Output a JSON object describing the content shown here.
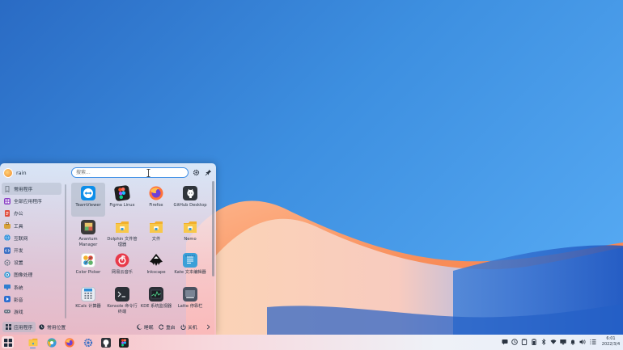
{
  "launcher": {
    "username": "rain",
    "search_placeholder": "搜索...",
    "sidebar": [
      {
        "label": "常用程序",
        "icon": "bookmark-icon",
        "color": "#6b7480"
      },
      {
        "label": "全部应用程序",
        "icon": "apps-grid-icon",
        "color": "#8a3fc4"
      },
      {
        "label": "办公",
        "icon": "office-icon",
        "color": "#e04a3a"
      },
      {
        "label": "工具",
        "icon": "tools-icon",
        "color": "#d8a23a"
      },
      {
        "label": "互联网",
        "icon": "globe-icon",
        "color": "#2e8fd8"
      },
      {
        "label": "开发",
        "icon": "code-icon",
        "color": "#3a6fc4"
      },
      {
        "label": "设置",
        "icon": "settings-icon",
        "color": "#5c6a7a"
      },
      {
        "label": "图像处理",
        "icon": "image-icon",
        "color": "#3aa0d8"
      },
      {
        "label": "系统",
        "icon": "system-icon",
        "color": "#2f7fd0"
      },
      {
        "label": "影音",
        "icon": "media-icon",
        "color": "#2e6fd0"
      },
      {
        "label": "游戏",
        "icon": "game-icon",
        "color": "#6a7684"
      }
    ],
    "apps": [
      {
        "label": "TeamViewer",
        "icon": "teamviewer-icon"
      },
      {
        "label": "Figma Linux",
        "icon": "figma-icon"
      },
      {
        "label": "Firefox",
        "icon": "firefox-icon"
      },
      {
        "label": "GitHub Desktop",
        "icon": "github-icon"
      },
      {
        "label": "Avantum Manager",
        "icon": "avantum-icon"
      },
      {
        "label": "Dolphin 文件管理器",
        "icon": "folder-icon"
      },
      {
        "label": "文件",
        "icon": "folder-icon"
      },
      {
        "label": "Nemo",
        "icon": "folder-icon"
      },
      {
        "label": "Color Picker",
        "icon": "color-picker-icon"
      },
      {
        "label": "网易云音乐",
        "icon": "netease-music-icon"
      },
      {
        "label": "Inkscape",
        "icon": "inkscape-icon"
      },
      {
        "label": "Kate 文本编辑器",
        "icon": "kate-icon"
      },
      {
        "label": "KCalc 计算器",
        "icon": "calculator-icon"
      },
      {
        "label": "Konsole 命令行终端",
        "icon": "terminal-icon"
      },
      {
        "label": "KDE 系统监视器",
        "icon": "system-monitor-icon"
      },
      {
        "label": "Latte 停靠栏",
        "icon": "latte-dock-icon"
      }
    ],
    "footer": {
      "tab_apps": "应用程序",
      "tab_places": "常用位置",
      "sleep": "睡眠",
      "restart": "重启",
      "shutdown": "关机"
    }
  },
  "taskbar": {
    "pinned": [
      "launcher-icon",
      "file-manager-icon",
      "browser-icon",
      "firefox-icon",
      "settings-icon",
      "github-icon",
      "figma-icon"
    ],
    "clock_time": "6:01",
    "clock_date": "2022/3/4"
  },
  "colors": {
    "accent": "#3d8ee6",
    "wallpaper_blue": "#3d8fe0",
    "wave_orange": "#f78a52",
    "wave_peach": "#f6c4a4"
  }
}
